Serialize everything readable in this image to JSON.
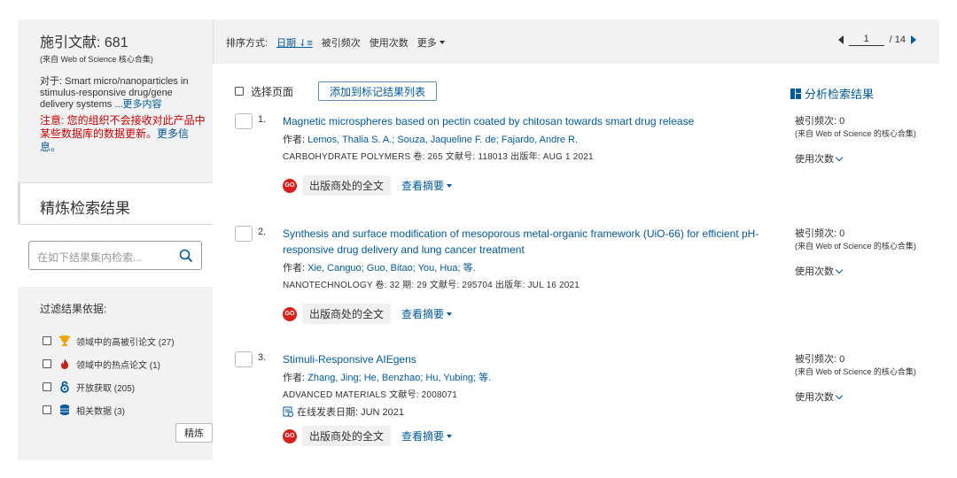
{
  "sidebar": {
    "title_label": "施引文献",
    "title_count": "681",
    "source_note": "(来自 Web of Science 核心合集)",
    "query_prefix": "对于: Smart micro/nanoparticles in stimulus-responsive drug/gene delivery systems",
    "query_more": "...更多内容",
    "warning_text": "注意: 您的组织不会接收对此产品中某些数据库的数据更新。",
    "warning_link": "更多信息。",
    "refine_title": "精炼检索结果",
    "search_placeholder": "在如下结果集内检索...",
    "filter_title": "过滤结果依据:",
    "filters": [
      {
        "label": "领域中的高被引论文 (27)",
        "icon": "trophy-icon",
        "color": "#f0a400"
      },
      {
        "label": "领域中的热点论文 (1)",
        "icon": "fire-icon",
        "color": "#c61f1f"
      },
      {
        "label": "开放获取 (205)",
        "icon": "open-access-icon",
        "color": "#005a9c"
      },
      {
        "label": "相关数据 (3)",
        "icon": "database-icon",
        "color": "#005a9c"
      }
    ],
    "refine_button": "精炼"
  },
  "toolbar": {
    "sort_label": "排序方式:",
    "sort_date": "日期",
    "sort_cited": "被引频次",
    "sort_usage": "使用次数",
    "sort_more": "更多",
    "page_current": "1",
    "page_total": "/ 14"
  },
  "select_row": {
    "select_page": "选择页面",
    "add_button": "添加到标记结果列表",
    "analyze": "分析检索结果"
  },
  "records": [
    {
      "num": "1.",
      "title": "Magnetic microspheres based on pectin coated by chitosan towards smart drug release",
      "author_prefix": "作者:",
      "authors": "Lemos, Thalia S. A.; Souza, Jaqueline F. de; Fajardo, Andre R.",
      "source": "CARBOHYDRATE POLYMERS  卷: 265   文献号: 118013  出版年: AUG 1 2021",
      "online": "",
      "fulltext": "出版商处的全文",
      "abstract": "查看摘要",
      "cited": "被引频次: 0",
      "cited_src": "(来自 Web of Science 的核心合集)",
      "usage": "使用次数"
    },
    {
      "num": "2.",
      "title": "Synthesis and surface modification of mesoporous metal-organic framework (UiO-66) for efficient pH-responsive drug delivery and lung cancer treatment",
      "author_prefix": "作者:",
      "authors": "Xie, Canguo; Guo, Bitao; You, Hua; 等.",
      "source": "NANOTECHNOLOGY  卷: 32  期: 29   文献号: 295704  出版年: JUL 16 2021",
      "online": "",
      "fulltext": "出版商处的全文",
      "abstract": "查看摘要",
      "cited": "被引频次: 0",
      "cited_src": "(来自 Web of Science 的核心合集)",
      "usage": "使用次数"
    },
    {
      "num": "3.",
      "title": "Stimuli-Responsive AIEgens",
      "author_prefix": "作者:",
      "authors": "Zhang, Jing; He, Benzhao; Hu, Yubing; 等.",
      "source": "ADVANCED MATERIALS   文献号: 2008071",
      "online": "在线发表日期: JUN 2021",
      "fulltext": "出版商处的全文",
      "abstract": "查看摘要",
      "cited": "被引频次: 0",
      "cited_src": "(来自 Web of Science 的核心合集)",
      "usage": "使用次数"
    }
  ]
}
